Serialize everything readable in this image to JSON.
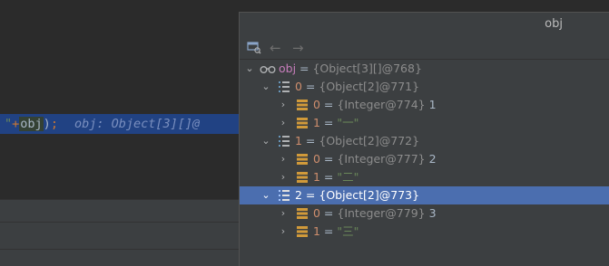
{
  "editor": {
    "code_quote": "\"",
    "code_plus": "+",
    "code_var": "obj",
    "code_paren": ")",
    "code_semi": ";",
    "inline_hint": "obj: Object[3][]@"
  },
  "popup": {
    "title": "obj",
    "toolbar": {
      "back_icon": "←",
      "forward_icon": "→"
    },
    "tree": {
      "root": {
        "name": "obj",
        "eq": " = ",
        "type": "{Object[3][]@768}",
        "icon": "watch-glasses-icon"
      },
      "rows": [
        {
          "name": "0",
          "eq": " = ",
          "type": "{Object[2]@771}",
          "value": "",
          "expanded": true
        },
        {
          "name": "0",
          "eq": " = ",
          "type": "{Integer@774}",
          "value": "1"
        },
        {
          "name": "1",
          "eq": " = ",
          "type": "",
          "value": "\"一\""
        },
        {
          "name": "1",
          "eq": " = ",
          "type": "{Object[2]@772}",
          "value": "",
          "expanded": true
        },
        {
          "name": "0",
          "eq": " = ",
          "type": "{Integer@777}",
          "value": "2"
        },
        {
          "name": "1",
          "eq": " = ",
          "type": "",
          "value": "\"二\""
        },
        {
          "name": "2",
          "eq": " = ",
          "type": "{Object[2]@773}",
          "value": "",
          "expanded": true,
          "selected": true
        },
        {
          "name": "0",
          "eq": " = ",
          "type": "{Integer@779}",
          "value": "3"
        },
        {
          "name": "1",
          "eq": " = ",
          "type": "",
          "value": "\"三\""
        }
      ]
    }
  },
  "colors": {
    "editor_bg": "#2b2b2b",
    "panel_bg": "#3c3f41",
    "selection": "#4b6eaf",
    "line_highlight": "#214283"
  }
}
